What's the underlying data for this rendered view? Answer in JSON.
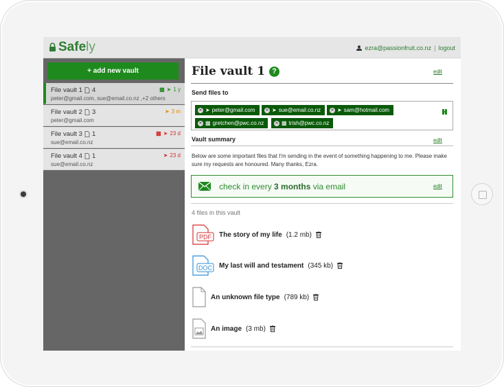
{
  "app": {
    "brand_strong": "Safe",
    "brand_light": "ly",
    "user_email": "ezra@passionfruit.co.nz",
    "separator": "|",
    "logout_label": "logout"
  },
  "sidebar": {
    "add_label": "+ add new vault",
    "vaults": [
      {
        "name": "File vault 1",
        "file_count": "4",
        "emails": "peter@gmail.com, sue@email.co.nz ,+2 others",
        "status_text": "1 y",
        "status_color": "#2e8b2e"
      },
      {
        "name": "File vault 2",
        "file_count": "3",
        "emails": "peter@gmail.com",
        "status_text": "3 m",
        "status_color": "#e68a00"
      },
      {
        "name": "File vault 3",
        "file_count": "1",
        "emails": "sue@email.co.nz",
        "status_text": "23 d",
        "status_color": "#d32f2f"
      },
      {
        "name": "File vault 4",
        "file_count": "1",
        "emails": "sue@email.co.nz",
        "status_text": "23 d",
        "status_color": "#d32f2f"
      }
    ]
  },
  "main": {
    "title": "File vault 1",
    "help_icon": "?",
    "edit_label": "edit",
    "send_to_label": "Send files to",
    "recipients": [
      {
        "label": "peter@gmail.com",
        "channel": "email"
      },
      {
        "label": "sue@email.co.nz",
        "channel": "email"
      },
      {
        "label": "sam@hotmail.com",
        "channel": "email"
      },
      {
        "label": "gretchen@pwc.co.nz",
        "channel": "message"
      },
      {
        "label": "trish@pwc.co.nz",
        "channel": "message"
      }
    ],
    "summary_label": "Vault summary",
    "summary_text": "Below are some important files that I'm sending in the event of something happening to me. Please make sure my requests are honoured. Many thanks, Ezra.",
    "checkin": {
      "prefix": "check in every",
      "interval": "3 months",
      "suffix": "via email"
    },
    "files_count_label": "4 files in this vault",
    "files": [
      {
        "name": "The story of my life",
        "size": "(1.2 mb)",
        "type": "PDF"
      },
      {
        "name": "My last will and testament",
        "size": "(345 kb)",
        "type": "DOC"
      },
      {
        "name": "An unknown file type",
        "size": "(789 kb)",
        "type": "unknown"
      },
      {
        "name": "An image",
        "size": "(3 mb)",
        "type": "image"
      }
    ]
  },
  "colors": {
    "brand_green": "#1e8a1e",
    "chip_green": "#0a5a0a",
    "sidebar_bg": "#666666",
    "pdf_red": "#d32f2f",
    "doc_blue": "#2f8fd8"
  }
}
